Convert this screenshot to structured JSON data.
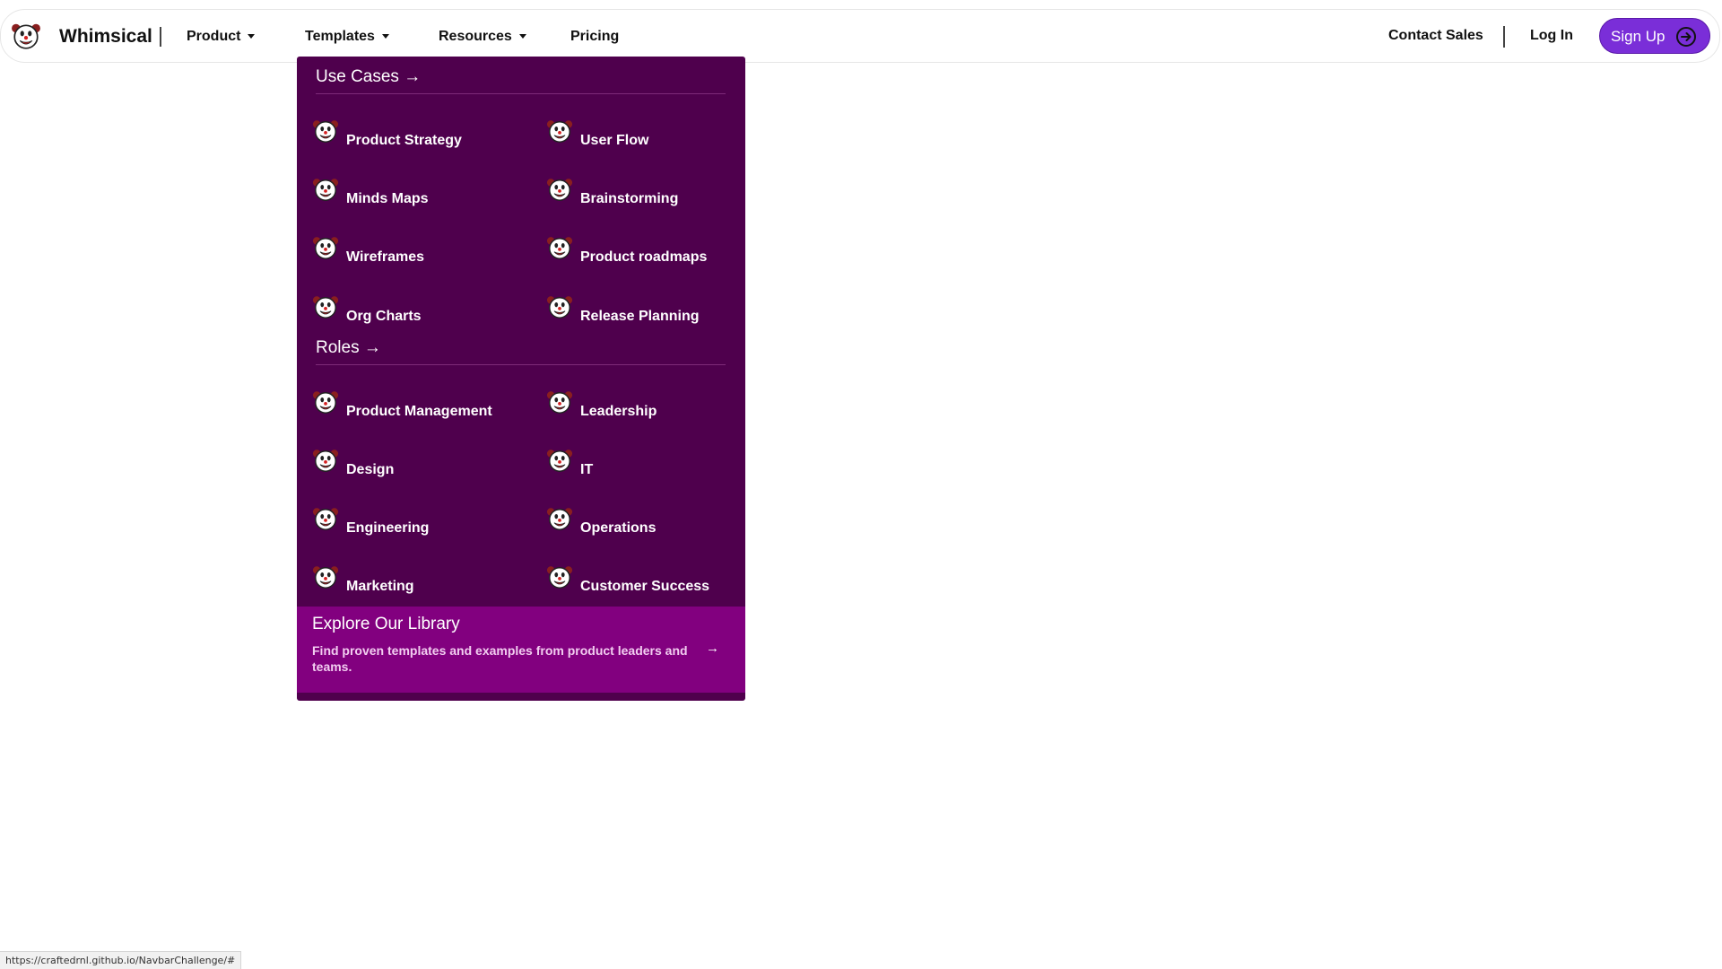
{
  "navbar": {
    "logo_icon": "clown-face-icon",
    "brand_name": "Whimsical",
    "items": [
      {
        "label": "Product",
        "has_dropdown": true
      },
      {
        "label": "Templates",
        "has_dropdown": true
      },
      {
        "label": "Resources",
        "has_dropdown": true
      },
      {
        "label": "Pricing",
        "has_dropdown": false
      }
    ],
    "contact_sales": "Contact Sales",
    "log_in": "Log In",
    "sign_up": "Sign Up",
    "sign_up_icon": "arrow-circle-right-icon"
  },
  "dropdown": {
    "item_icon": "clown-face-icon",
    "use_cases": {
      "heading": "Use Cases →",
      "items": [
        "Product Strategy",
        "User Flow",
        "Minds Maps",
        "Brainstorming",
        "Wireframes",
        "Product roadmaps",
        "Org Charts",
        "Release Planning"
      ]
    },
    "roles": {
      "heading": "Roles →",
      "items": [
        "Product Management",
        "Leadership",
        "Design",
        "IT",
        "Engineering",
        "Operations",
        "Marketing",
        "Customer Success"
      ]
    },
    "library": {
      "title": "Explore Our Library",
      "description": "Find proven templates and examples from product leaders and teams.",
      "arrow": "→"
    }
  },
  "status_bar": {
    "url": "https://craftedrnl.github.io/NavbarChallenge/#"
  },
  "colors": {
    "dropdown_background": "#4f004d",
    "library_background": "#82007f",
    "sign_up_button": "#7a2ed8"
  }
}
